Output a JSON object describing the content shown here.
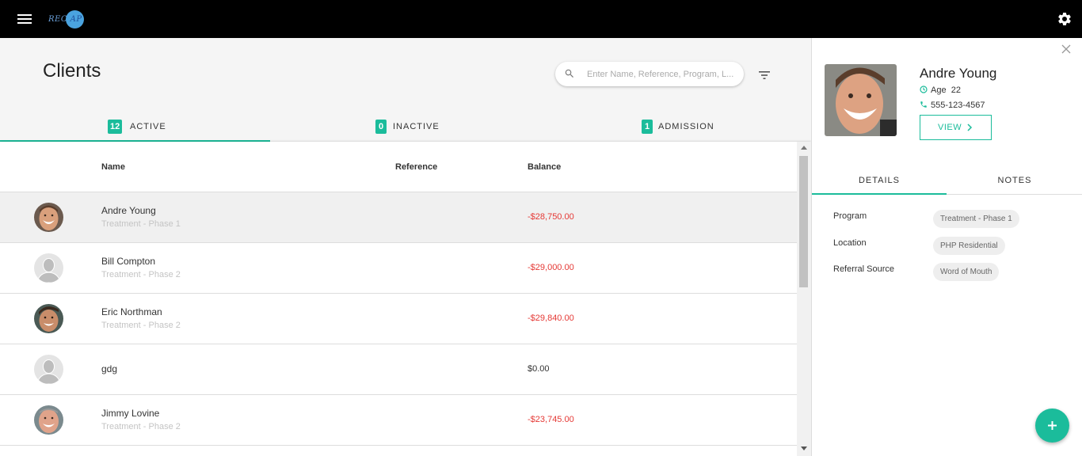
{
  "app": {
    "logo_text_left": "REC",
    "logo_text_right": "AP",
    "menu_icon": "hamburger-menu-icon",
    "settings_icon": "gear-icon"
  },
  "page": {
    "title": "Clients",
    "search_placeholder": "Enter Name, Reference, Program, L...",
    "filter_icon": "filter-icon"
  },
  "tabs": [
    {
      "count": "12",
      "label": "ACTIVE",
      "active": true
    },
    {
      "count": "0",
      "label": "INACTIVE",
      "active": false
    },
    {
      "count": "1",
      "label": "ADMISSION",
      "active": false
    }
  ],
  "table": {
    "columns": [
      "Name",
      "Reference",
      "Balance"
    ],
    "rows": [
      {
        "name": "Andre Young",
        "program": "Treatment - Phase 1",
        "reference": "",
        "balance": "-$28,750.00",
        "avatar": "photo",
        "selected": true
      },
      {
        "name": "Bill Compton",
        "program": "Treatment - Phase 2",
        "reference": "",
        "balance": "-$29,000.00",
        "avatar": "placeholder",
        "selected": false
      },
      {
        "name": "Eric Northman",
        "program": "Treatment - Phase 2",
        "reference": "",
        "balance": "-$29,840.00",
        "avatar": "photo",
        "selected": false
      },
      {
        "name": "gdg",
        "program": "",
        "reference": "",
        "balance": "$0.00",
        "avatar": "placeholder",
        "selected": false
      },
      {
        "name": "Jimmy Lovine",
        "program": "Treatment - Phase 2",
        "reference": "",
        "balance": "-$23,745.00",
        "avatar": "photo",
        "selected": false
      }
    ]
  },
  "detail": {
    "name": "Andre Young",
    "age_label": "Age",
    "age": "22",
    "phone": "555-123-4567",
    "view_label": "VIEW",
    "tabs": [
      "DETAILS",
      "NOTES"
    ],
    "fields": [
      {
        "label": "Program",
        "value": "Treatment - Phase 1"
      },
      {
        "label": "Location",
        "value": "PHP Residential"
      },
      {
        "label": "Referral Source",
        "value": "Word of Mouth"
      }
    ]
  },
  "colors": {
    "accent": "#1bbc9b",
    "negative": "#e53935",
    "topbar": "#000000"
  }
}
